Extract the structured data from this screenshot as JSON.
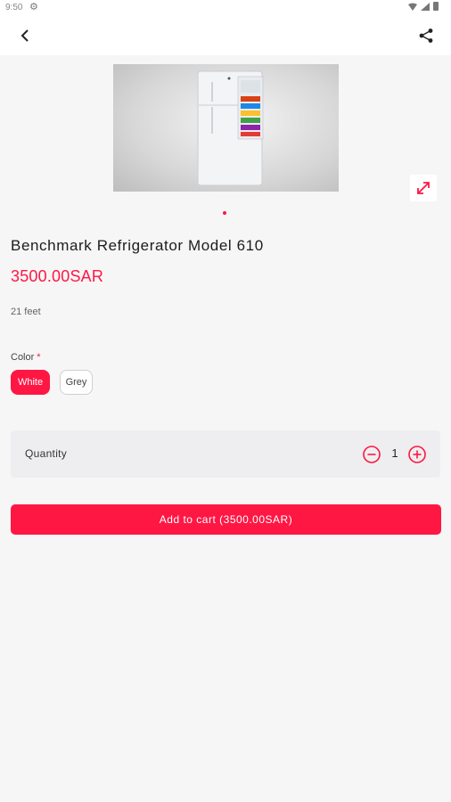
{
  "status_bar": {
    "time": "9:50"
  },
  "product": {
    "title": "Benchmark Refrigerator Model 610",
    "price": "3500.00SAR",
    "description": "21 feet"
  },
  "color": {
    "label": "Color",
    "required_mark": "*",
    "options": [
      "White",
      "Grey"
    ],
    "selected": "White"
  },
  "quantity": {
    "label": "Quantity",
    "value": "1"
  },
  "cart_button": {
    "label": "Add to cart (3500.00SAR)"
  },
  "colors": {
    "accent": "#ff1744",
    "background": "#f6f6f6"
  },
  "icons": [
    "gear-icon",
    "wifi-icon",
    "signal-icon",
    "battery-icon",
    "back-arrow-icon",
    "share-icon",
    "expand-icon",
    "minus-circle-icon",
    "plus-circle-icon"
  ]
}
